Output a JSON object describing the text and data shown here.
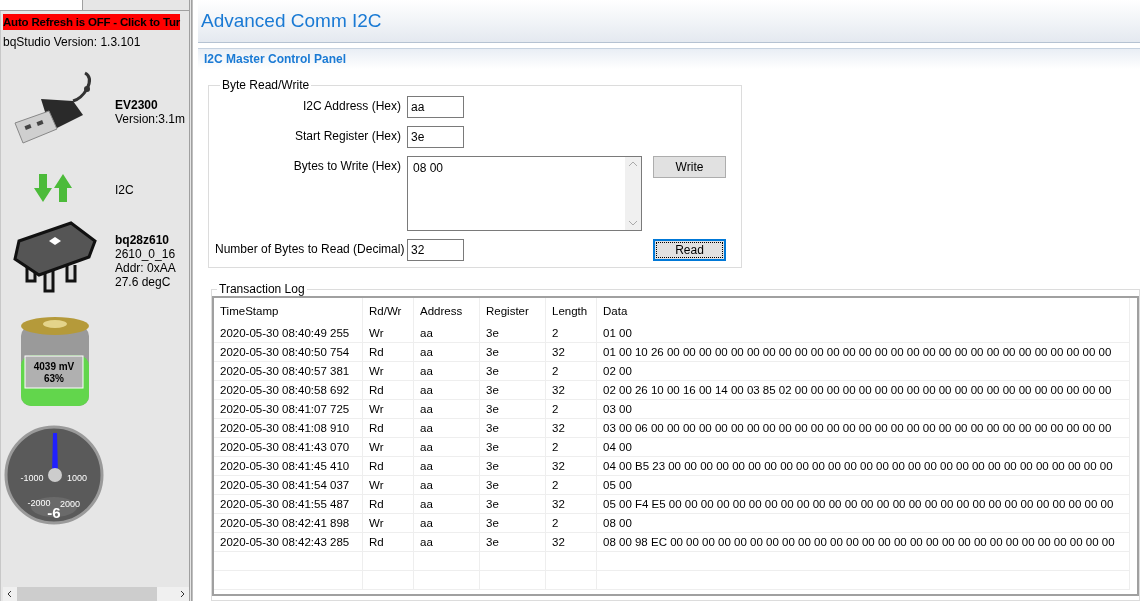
{
  "sidebar": {
    "auto_refresh_banner": "Auto Refresh is OFF - Click to Tur",
    "version_label": "bqStudio Version:  1.3.101",
    "adapter": {
      "name": "EV2300",
      "version": "Version:3.1m"
    },
    "bus": {
      "name": "I2C"
    },
    "device": {
      "name": "bq28z610",
      "lines": [
        "2610_0_16",
        "Addr: 0xAA",
        "27.6 degC"
      ]
    },
    "battery": {
      "voltage": "4039 mV",
      "charge": "63%",
      "level": 0.63
    },
    "gauge": {
      "ticks": [
        "-1000",
        "1000",
        "-2000",
        "2000"
      ],
      "reading": "-6"
    }
  },
  "header": {
    "title": "Advanced Comm I2C"
  },
  "panel": {
    "title": "I2C Master Control Panel",
    "byte_read_write": {
      "legend": "Byte Read/Write",
      "i2c_address": {
        "label": "I2C Address (Hex)",
        "value": "aa"
      },
      "start_register": {
        "label": "Start Register (Hex)",
        "value": "3e"
      },
      "bytes_to_write": {
        "label": "Bytes to Write (Hex)",
        "value": "08 00"
      },
      "write_button": "Write",
      "bytes_to_read": {
        "label": "Number of Bytes to Read (Decimal)",
        "value": "32"
      },
      "read_button": "Read"
    },
    "transaction_log": {
      "legend": "Transaction Log",
      "columns": [
        "TimeStamp",
        "Rd/Wr",
        "Address",
        "Register",
        "Length",
        "Data"
      ],
      "rows": [
        [
          "2020-05-30 08:40:49 255",
          "Wr",
          "aa",
          "3e",
          "2",
          "01 00"
        ],
        [
          "2020-05-30 08:40:50 754",
          "Rd",
          "aa",
          "3e",
          "32",
          "01 00 10 26 00 00 00 00 00 00 00 00 00 00 00 00 00 00 00 00 00 00 00 00 00 00 00 00 00 00 00 00"
        ],
        [
          "2020-05-30 08:40:57 381",
          "Wr",
          "aa",
          "3e",
          "2",
          "02 00"
        ],
        [
          "2020-05-30 08:40:58 692",
          "Rd",
          "aa",
          "3e",
          "32",
          "02 00 26 10 00 16 00 14 00 03 85 02 00 00 00 00 00 00 00 00 00 00 00 00 00 00 00 00 00 00 00 00"
        ],
        [
          "2020-05-30 08:41:07 725",
          "Wr",
          "aa",
          "3e",
          "2",
          "03 00"
        ],
        [
          "2020-05-30 08:41:08 910",
          "Rd",
          "aa",
          "3e",
          "32",
          "03 00 06 00 00 00 00 00 00 00 00 00 00 00 00 00 00 00 00 00 00 00 00 00 00 00 00 00 00 00 00 00"
        ],
        [
          "2020-05-30 08:41:43 070",
          "Wr",
          "aa",
          "3e",
          "2",
          "04 00"
        ],
        [
          "2020-05-30 08:41:45 410",
          "Rd",
          "aa",
          "3e",
          "32",
          "04 00 B5 23 00 00 00 00 00 00 00 00 00 00 00 00 00 00 00 00 00 00 00 00 00 00 00 00 00 00 00 00"
        ],
        [
          "2020-05-30 08:41:54 037",
          "Wr",
          "aa",
          "3e",
          "2",
          "05 00"
        ],
        [
          "2020-05-30 08:41:55 487",
          "Rd",
          "aa",
          "3e",
          "32",
          "05 00 F4 E5 00 00 00 00 00 00 00 00 00 00 00 00 00 00 00 00 00 00 00 00 00 00 00 00 00 00 00 00"
        ],
        [
          "2020-05-30 08:42:41 898",
          "Wr",
          "aa",
          "3e",
          "2",
          "08 00"
        ],
        [
          "2020-05-30 08:42:43 285",
          "Rd",
          "aa",
          "3e",
          "32",
          "08 00 98 EC 00 00 00 00 00 00 00 00 00 00 00 00 00 00 00 00 00 00 00 00 00 00 00 00 00 00 00 00"
        ]
      ]
    }
  }
}
